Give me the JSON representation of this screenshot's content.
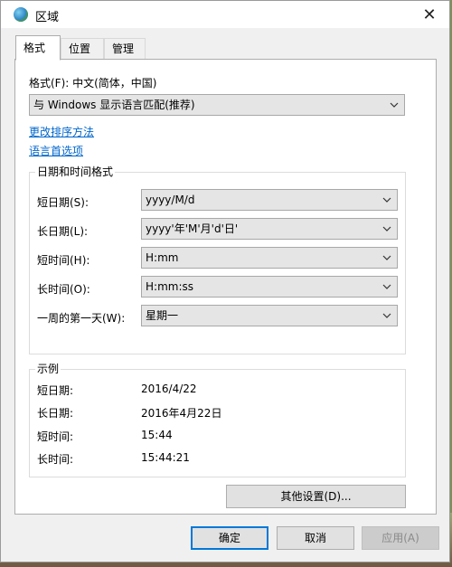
{
  "window": {
    "title": "区域",
    "close_glyph": "✕"
  },
  "tabs": [
    {
      "label": "格式",
      "active": true
    },
    {
      "label": "位置",
      "active": false
    },
    {
      "label": "管理",
      "active": false
    }
  ],
  "format": {
    "label": "格式(F): 中文(简体，中国)",
    "selected": "与 Windows 显示语言匹配(推荐)"
  },
  "links": {
    "sort": "更改排序方法",
    "language_prefs": "语言首选项"
  },
  "datetime_group": {
    "title": "日期和时间格式",
    "rows": [
      {
        "label": "短日期(S):",
        "value": "yyyy/M/d"
      },
      {
        "label": "长日期(L):",
        "value": "yyyy'年'M'月'd'日'"
      },
      {
        "label": "短时间(H):",
        "value": "H:mm"
      },
      {
        "label": "长时间(O):",
        "value": "H:mm:ss"
      },
      {
        "label": "一周的第一天(W):",
        "value": "星期一"
      }
    ]
  },
  "example_group": {
    "title": "示例",
    "rows": [
      {
        "label": "短日期:",
        "value": "2016/4/22"
      },
      {
        "label": "长日期:",
        "value": "2016年4月22日"
      },
      {
        "label": "短时间:",
        "value": "15:44"
      },
      {
        "label": "长时间:",
        "value": "15:44:21"
      }
    ]
  },
  "buttons": {
    "other_settings": "其他设置(D)...",
    "ok": "确定",
    "cancel": "取消",
    "apply": "应用(A)"
  },
  "colors": {
    "accent": "#0078d7",
    "link": "#0066cc"
  },
  "icons": {
    "title": "globe-icon",
    "close": "close-icon",
    "dropdown": "chevron-down-icon"
  }
}
